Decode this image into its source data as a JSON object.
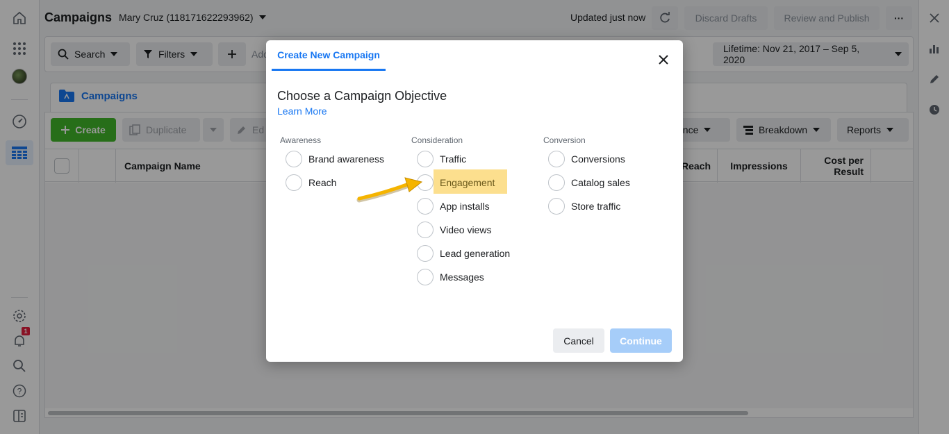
{
  "header": {
    "title": "Campaigns",
    "account": "Mary Cruz (118171622293962)",
    "updated": "Updated just now",
    "discard": "Discard Drafts",
    "review": "Review and Publish",
    "more": "···"
  },
  "toolbar": {
    "search": "Search",
    "filters": "Filters",
    "add": "Add",
    "date_range": "Lifetime: Nov 21, 2017 – Sep 5, 2020"
  },
  "tab": {
    "label": "Campaigns"
  },
  "actions": {
    "create": "Create",
    "duplicate": "Duplicate",
    "edit": "Ed",
    "performance": "ance",
    "breakdown": "Breakdown",
    "reports": "Reports"
  },
  "table": {
    "columns": [
      "Campaign Name",
      "Reach",
      "Impressions",
      "Cost per Result"
    ]
  },
  "notifications": {
    "count": "1"
  },
  "modal": {
    "tab": "Create New Campaign",
    "title": "Choose a Campaign Objective",
    "learn_more": "Learn More",
    "groups": [
      {
        "label": "Awareness",
        "options": [
          "Brand awareness",
          "Reach"
        ]
      },
      {
        "label": "Consideration",
        "options": [
          "Traffic",
          "Engagement",
          "App installs",
          "Video views",
          "Lead generation",
          "Messages"
        ]
      },
      {
        "label": "Conversion",
        "options": [
          "Conversions",
          "Catalog sales",
          "Store traffic"
        ]
      }
    ],
    "highlighted": "Engagement",
    "cancel": "Cancel",
    "continue": "Continue"
  },
  "colors": {
    "accent": "#1877f2",
    "create_green": "#42b72a",
    "highlight": "#fcd97a",
    "arrow": "#f5b400"
  }
}
